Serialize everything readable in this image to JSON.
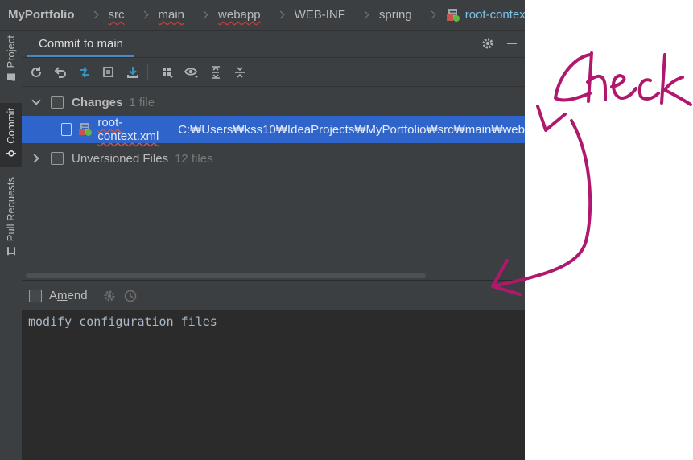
{
  "breadcrumb": {
    "project": "MyPortfolio",
    "items": [
      "src",
      "main",
      "webapp",
      "WEB-INF",
      "spring"
    ],
    "file": "root-context.xml"
  },
  "strip": {
    "tabs": [
      "Project",
      "Commit",
      "Pull Requests"
    ]
  },
  "tool_window": {
    "tab_label": "Commit to main",
    "icons": [
      "gear-icon",
      "minimize-icon"
    ]
  },
  "toolbar": {
    "icons": [
      "refresh-icon",
      "rollback-icon",
      "diff-icon",
      "shelve-icon",
      "update-icon",
      "group-by-icon",
      "view-options-icon",
      "expand-all-icon",
      "collapse-all-icon"
    ]
  },
  "changes": {
    "label": "Changes",
    "count": "1 file",
    "files": [
      {
        "name": "root-context.xml",
        "path": "C:₩Users₩kss10₩IdeaProjects₩MyPortfolio₩src₩main₩web"
      }
    ]
  },
  "unversioned": {
    "label": "Unversioned Files",
    "count": "12 files"
  },
  "amend": {
    "label_pre": "A",
    "label_u": "m",
    "label_post": "end"
  },
  "commit_message": "modify configuration files",
  "annotation": {
    "text": "check",
    "color": "#b0186e"
  }
}
